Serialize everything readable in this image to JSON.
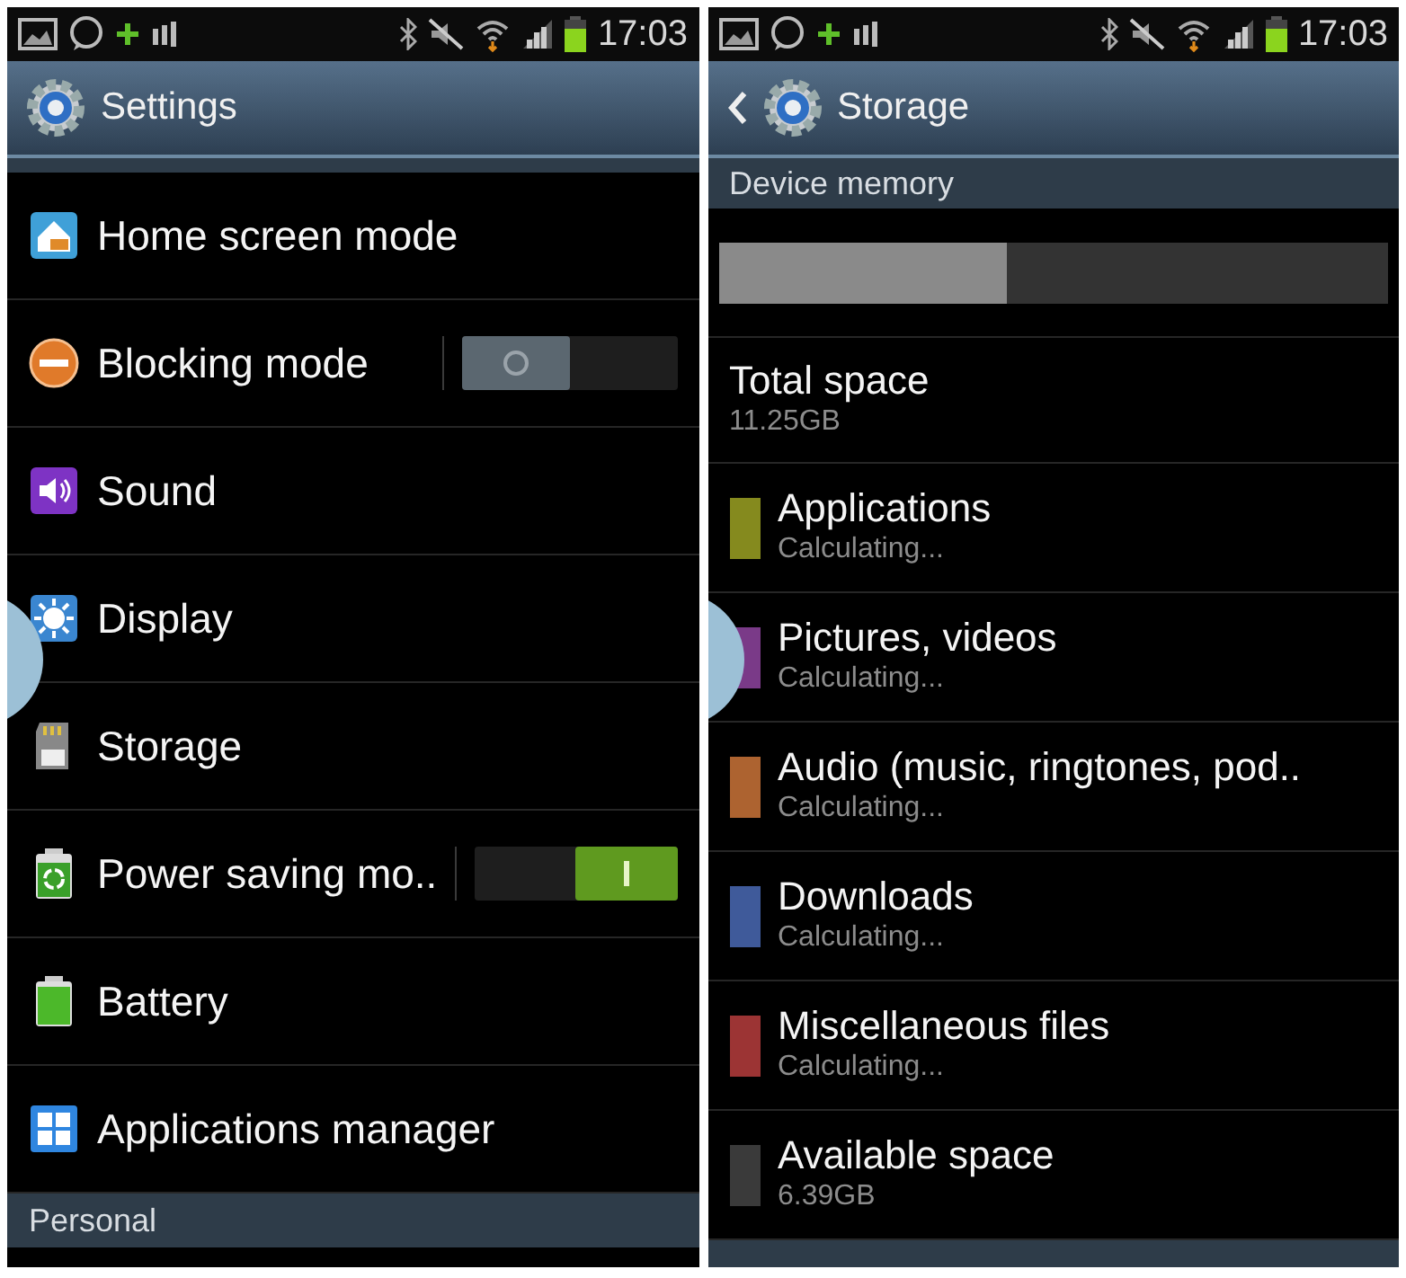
{
  "settings": {
    "status_bar": {
      "time": "17:03"
    },
    "header": {
      "title": "Settings",
      "back": false
    },
    "items": [
      {
        "label": "Home screen mode",
        "kind": "plain"
      },
      {
        "label": "Blocking mode",
        "kind": "toggle",
        "on": false
      },
      {
        "label": "Sound",
        "kind": "plain"
      },
      {
        "label": "Display",
        "kind": "plain"
      },
      {
        "label": "Storage",
        "kind": "plain"
      },
      {
        "label": "Power saving mo..",
        "kind": "toggle",
        "on": true
      },
      {
        "label": "Battery",
        "kind": "plain"
      },
      {
        "label": "Applications manager",
        "kind": "plain"
      }
    ],
    "section": "Personal"
  },
  "storage": {
    "status_bar": {
      "time": "17:03"
    },
    "header": {
      "title": "Storage",
      "back": true
    },
    "section": "Device memory",
    "memory_bar": {
      "level": 0.43
    },
    "total": {
      "label": "Total space",
      "value": "11.25GB"
    },
    "categories": [
      {
        "label": "Applications",
        "status": "Calculating...",
        "color": "#858a1e"
      },
      {
        "label": "Pictures, videos",
        "status": "Calculating...",
        "color": "#7a3a88"
      },
      {
        "label": "Audio (music, ringtones, pod..",
        "status": "Calculating...",
        "color": "#ad6330"
      },
      {
        "label": "Downloads",
        "status": "Calculating...",
        "color": "#3f5a9a"
      },
      {
        "label": "Miscellaneous files",
        "status": "Calculating...",
        "color": "#9c3434"
      },
      {
        "label": "Available space",
        "status": "6.39GB",
        "color": "#3a3a3a"
      }
    ]
  }
}
